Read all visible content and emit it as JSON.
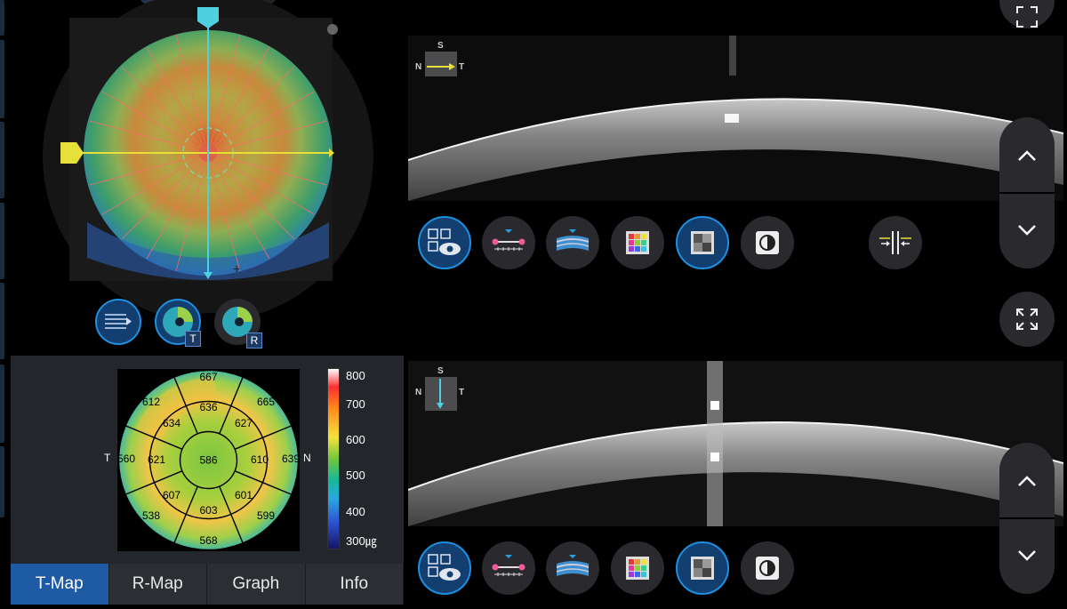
{
  "colors": {
    "accent": "#1f8fe0",
    "active_tab": "#1f5ba4",
    "panel": "#23262b",
    "button": "#2a2a2e",
    "h_line": "#e8e03a",
    "v_line": "#4fd0e0"
  },
  "fundus": {
    "icons": [
      "horizontal-marker-icon",
      "vertical-marker-icon",
      "pin-icon"
    ]
  },
  "map_toolbar": [
    {
      "name": "list-view-button",
      "icon": "list-arrow-icon",
      "badge": ""
    },
    {
      "name": "thickness-map-button",
      "icon": "eye-map-icon",
      "badge": "T"
    },
    {
      "name": "reference-map-button",
      "icon": "eye-map-icon",
      "badge": "R"
    }
  ],
  "thickness_map": {
    "sectors": {
      "center": "586",
      "inner_superior": "636",
      "inner_superior_nasal": "627",
      "inner_nasal": "610",
      "inner_inferior_nasal": "601",
      "inner_inferior": "603",
      "inner_inferior_temporal": "607",
      "inner_temporal": "621",
      "inner_superior_temporal": "634",
      "outer_superior": "667",
      "outer_superior_nasal": "665",
      "outer_nasal": "639",
      "outer_inferior_nasal": "599",
      "outer_inferior": "568",
      "outer_inferior_temporal": "538",
      "outer_temporal": "560",
      "outer_superior_temporal": "612"
    },
    "temporal_label": "T",
    "nasal_label": "N",
    "scale_labels": [
      "800",
      "700",
      "600",
      "500",
      "400",
      "300㎍"
    ]
  },
  "tabs": [
    {
      "label": "T-Map",
      "active": true
    },
    {
      "label": "R-Map",
      "active": false
    },
    {
      "label": "Graph",
      "active": false
    },
    {
      "label": "Info",
      "active": false
    }
  ],
  "scans": [
    {
      "orientation": {
        "s": "S",
        "n": "N",
        "t": "T",
        "arrow": "horizontal",
        "arrow_color": "#e8e03a"
      },
      "toolbar": [
        {
          "name": "eye-view-button",
          "icon": "eye-grid-icon",
          "active": true
        },
        {
          "name": "caliper-button",
          "icon": "caliper-icon",
          "active": false
        },
        {
          "name": "layer-button",
          "icon": "layer-icon",
          "active": false
        },
        {
          "name": "color-map-button",
          "icon": "color-grid-icon",
          "active": false
        },
        {
          "name": "grayscale-button",
          "icon": "gray-grid-icon",
          "active": true
        },
        {
          "name": "contrast-button",
          "icon": "contrast-icon",
          "active": false
        },
        {
          "name": "compare-split-button",
          "icon": "split-compare-icon",
          "active": false
        }
      ]
    },
    {
      "orientation": {
        "s": "S",
        "n": "N",
        "t": "T",
        "arrow": "vertical",
        "arrow_color": "#4fd0e0"
      },
      "toolbar": [
        {
          "name": "eye-view-button",
          "icon": "eye-grid-icon",
          "active": true
        },
        {
          "name": "caliper-button",
          "icon": "caliper-icon",
          "active": false
        },
        {
          "name": "layer-button",
          "icon": "layer-icon",
          "active": false
        },
        {
          "name": "color-map-button",
          "icon": "color-grid-icon",
          "active": false
        },
        {
          "name": "grayscale-button",
          "icon": "gray-grid-icon",
          "active": true
        },
        {
          "name": "contrast-button",
          "icon": "contrast-icon",
          "active": false
        }
      ]
    }
  ],
  "side_controls": {
    "icons": [
      "expand-icon",
      "chevron-up-icon",
      "chevron-down-icon"
    ]
  }
}
